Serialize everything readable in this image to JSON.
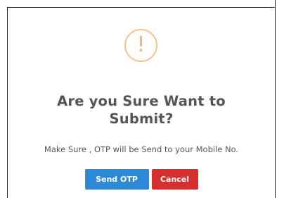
{
  "dialog": {
    "icon": "exclamation-warning-icon",
    "icon_glyph": "!",
    "title_line1": "Are you Sure Want to",
    "title_line2": "Submit?",
    "message": "Make Sure , OTP will be Send to your Mobile No.",
    "confirm_label": "Send OTP",
    "cancel_label": "Cancel"
  },
  "colors": {
    "icon": "#f2b37a",
    "confirm": "#2d89d6",
    "cancel": "#d62f2f",
    "title": "#555555"
  }
}
